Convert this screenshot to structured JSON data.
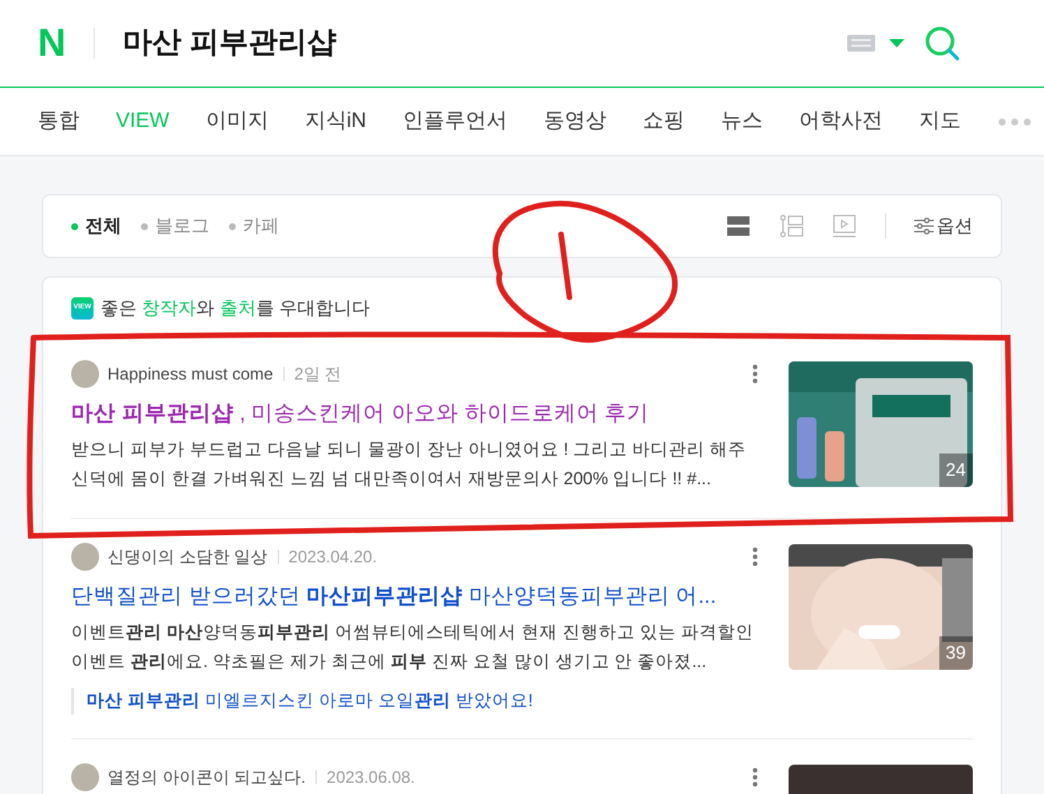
{
  "header": {
    "logo": "N",
    "query": "마산 피부관리샵"
  },
  "tabs": [
    {
      "label": "통합",
      "selected": false
    },
    {
      "label": "VIEW",
      "selected": true
    },
    {
      "label": "이미지",
      "selected": false
    },
    {
      "label": "지식iN",
      "selected": false
    },
    {
      "label": "인플루언서",
      "selected": false
    },
    {
      "label": "동영상",
      "selected": false
    },
    {
      "label": "쇼핑",
      "selected": false
    },
    {
      "label": "뉴스",
      "selected": false
    },
    {
      "label": "어학사전",
      "selected": false
    },
    {
      "label": "지도",
      "selected": false
    }
  ],
  "filters": [
    {
      "label": "전체",
      "selected": true
    },
    {
      "label": "블로그",
      "selected": false
    },
    {
      "label": "카페",
      "selected": false
    }
  ],
  "view_modes": [
    {
      "kind": "list",
      "selected": true
    },
    {
      "kind": "timeline",
      "selected": false
    },
    {
      "kind": "video",
      "selected": false
    }
  ],
  "options_label": "옵션",
  "notice": {
    "badge": "VIEW",
    "text": "좋은 **창작자**와 **출처**를 우대합니다"
  },
  "posts": [
    {
      "author": "Happiness must come",
      "date": "2일 전",
      "visited": true,
      "title": "**마산 피부관리샵** , 미송스킨케어 아오와 하이드로케어 후기",
      "description": "받으니 피부가 부드럽고 다음날 되니 물광이 장난 아니였어요 ! 그리고 바디관리 해주신덕에 몸이 한결 가벼워진 느낌 넘 대만족이여서 재방문의사 200% 입니다 !! #...",
      "photo_count": "24"
    },
    {
      "author": "신댕이의 소담한 일상",
      "date": "2023.04.20.",
      "visited": false,
      "title": "단백질관리 받으러갔던 **마산피부관리샵** 마산양덕동피부관리 어...",
      "description": "이벤트**관리** **마산**양덕동**피부관리** 어썸뷰티에스테틱에서 현재 진행하고 있는 파격할인이벤트 **관리**에요. 약초필은 제가 최근에 **피부** 진짜 요철 많이 생기고 안 좋아졌...",
      "sublink": "**마산 피부관리** 미엘르지스킨 아로마 오일**관리** 받았어요!",
      "photo_count": "39"
    },
    {
      "author": "열정의 아이콘이 되고싶다.",
      "date": "2023.06.08."
    }
  ]
}
